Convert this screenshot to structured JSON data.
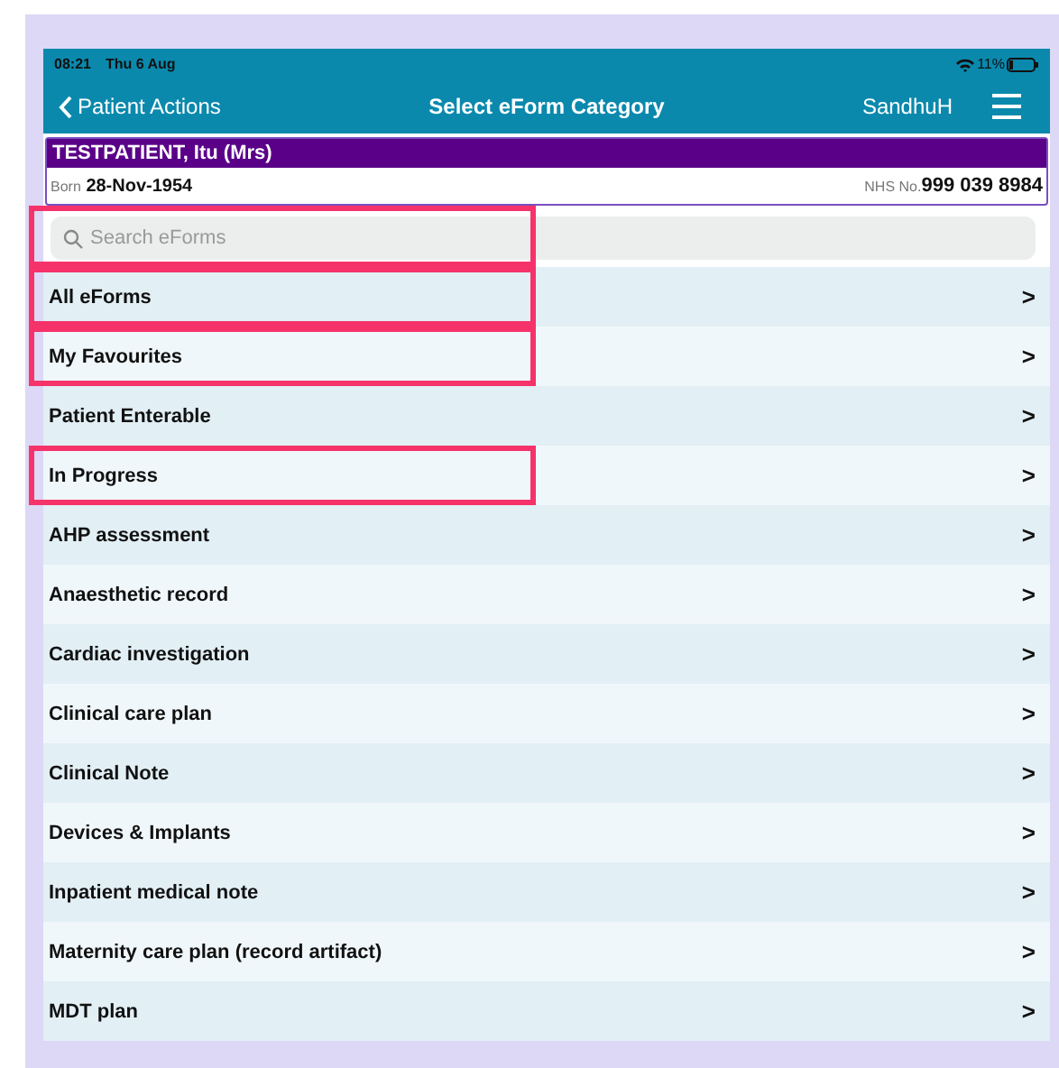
{
  "status_bar": {
    "time": "08:21",
    "date": "Thu 6 Aug",
    "battery": "11%"
  },
  "nav": {
    "back": "Patient Actions",
    "title": "Select eForm Category",
    "user": "SandhuH"
  },
  "patient": {
    "name": "TESTPATIENT, Itu (Mrs)",
    "born_label": "Born",
    "born": "28-Nov-1954",
    "nhs_label": "NHS No.",
    "nhs": "999 039 8984"
  },
  "search": {
    "placeholder": "Search eForms",
    "highlighted": true
  },
  "rows": [
    {
      "label": "All eForms",
      "chevron": ">",
      "highlighted": true
    },
    {
      "label": "My Favourites",
      "chevron": ">",
      "highlighted": true
    },
    {
      "label": "Patient Enterable",
      "chevron": ">",
      "highlighted": false
    },
    {
      "label": "In Progress",
      "chevron": ">",
      "highlighted": true
    },
    {
      "label": "AHP assessment",
      "chevron": ">",
      "highlighted": false
    },
    {
      "label": "Anaesthetic record",
      "chevron": ">",
      "highlighted": false
    },
    {
      "label": "Cardiac investigation",
      "chevron": ">",
      "highlighted": false
    },
    {
      "label": "Clinical care plan",
      "chevron": ">",
      "highlighted": false
    },
    {
      "label": "Clinical Note",
      "chevron": ">",
      "highlighted": false
    },
    {
      "label": "Devices & Implants",
      "chevron": ">",
      "highlighted": false
    },
    {
      "label": "Inpatient medical note",
      "chevron": ">",
      "highlighted": false
    },
    {
      "label": "Maternity care plan (record artifact)",
      "chevron": ">",
      "highlighted": false
    },
    {
      "label": "MDT plan",
      "chevron": ">",
      "highlighted": false
    }
  ]
}
